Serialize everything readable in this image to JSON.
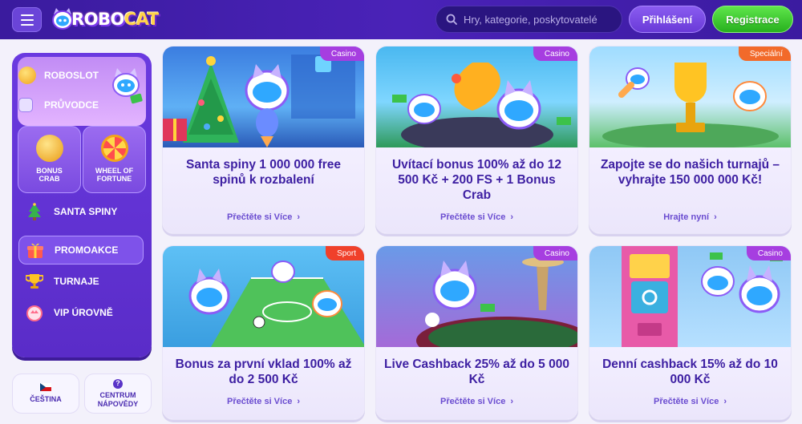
{
  "header": {
    "logo_text_a": "ROBO",
    "logo_text_b": "CAT",
    "search_placeholder": "Hry, kategorie, poskytovatelé",
    "login_label": "Přihlášení",
    "register_label": "Registrace",
    "icons": [
      "menu-icon",
      "search-icon"
    ]
  },
  "sidebar": {
    "top_items": [
      {
        "label": "ROBOSLOT",
        "icon": "coin-icon"
      },
      {
        "label": "PRŮVODCE",
        "icon": "guide-icon"
      }
    ],
    "tiles": [
      {
        "label": "BONUS CRAB",
        "icon": "crab-coin-icon"
      },
      {
        "label": "WHEEL OF FORTUNE",
        "icon": "wheel-icon"
      }
    ],
    "items": [
      {
        "label": "SANTA SPINY",
        "icon": "christmas-tree-icon",
        "active": false
      },
      {
        "label": "PROMOAKCE",
        "icon": "gift-icon",
        "active": true
      },
      {
        "label": "TURNAJE",
        "icon": "trophy-icon",
        "active": false
      },
      {
        "label": "VIP ÚROVNĚ",
        "icon": "vip-icon",
        "active": false
      }
    ],
    "language_label": "ČEŠTINA",
    "help_label_line1": "CENTRUM",
    "help_label_line2": "NÁPOVĚDY"
  },
  "promotions": [
    {
      "badge": "Casino",
      "badge_color": "#a63ee0",
      "title": "Santa spiny 1 000 000 free spinů k rozbalení",
      "link": "Přečtěte si Více"
    },
    {
      "badge": "Casino",
      "badge_color": "#a63ee0",
      "title": "Uvítací bonus 100% až do 12 500 Kč + 200 FS + 1 Bonus Crab",
      "link": "Přečtěte si Více"
    },
    {
      "badge": "Speciální",
      "badge_color": "#f26a2a",
      "title": "Zapojte se do našich turnajů – vyhrajte 150 000 000 Kč!",
      "link": "Hrajte nyní"
    },
    {
      "badge": "Sport",
      "badge_color": "#f0402a",
      "title": "Bonus za první vklad 100% až do 2 500 Kč",
      "link": "Přečtěte si Více"
    },
    {
      "badge": "Casino",
      "badge_color": "#a63ee0",
      "title": "Live Cashback 25% až do 5 000 Kč",
      "link": "Přečtěte si Více"
    },
    {
      "badge": "Casino",
      "badge_color": "#a63ee0",
      "title": "Denní cashback 15% až do 10 000 Kč",
      "link": "Přečtěte si Více"
    }
  ],
  "colors": {
    "header_bg": "#4a22b8",
    "accent_purple": "#6a3ae0",
    "accent_green": "#27b01e",
    "title_text": "#3d1fa2"
  }
}
